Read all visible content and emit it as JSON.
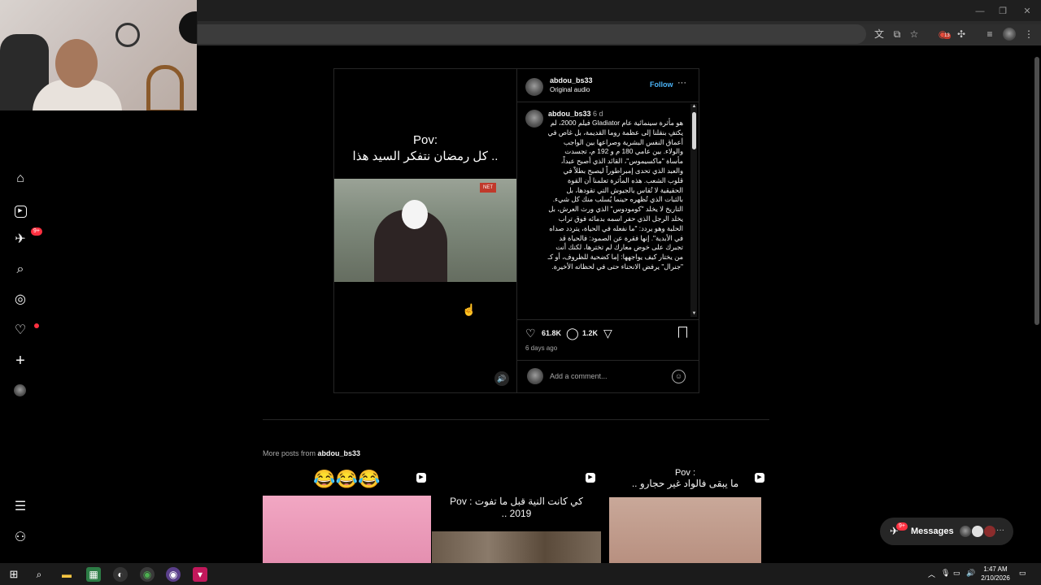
{
  "browser": {
    "window_controls": [
      "—",
      "❐",
      "✕"
    ],
    "toolbar_icons": [
      "translate-icon",
      "install-icon",
      "star-icon",
      "extension-ad-icon",
      "puzzle-icon",
      "tab-search-icon",
      "profile-icon",
      "menu-icon"
    ],
    "extension_badge": "13"
  },
  "sidebar": {
    "items": [
      {
        "name": "home",
        "glyph": "⌂"
      },
      {
        "name": "reels",
        "glyph": "▶"
      },
      {
        "name": "direct",
        "glyph": "✈",
        "badge": "9+"
      },
      {
        "name": "search",
        "glyph": "⌕"
      },
      {
        "name": "explore",
        "glyph": "◎"
      },
      {
        "name": "notifications",
        "glyph": "♡"
      },
      {
        "name": "create",
        "glyph": "+"
      },
      {
        "name": "profile",
        "glyph": "●"
      }
    ],
    "more_glyph": "☰",
    "threads_glyph": "⚇"
  },
  "post": {
    "media": {
      "pov_line1": "Pov:",
      "pov_line2": "كل رمضان نتفكر السيد هذا ..",
      "video_tag": "NET"
    },
    "header": {
      "username": "abdou_bs33",
      "audio": "Original audio",
      "follow_label": "Follow",
      "more_glyph": "···"
    },
    "caption": {
      "username": "abdou_bs33",
      "time": "6 d",
      "text": "هو مأثرة سينمائية عام Gladiator فيلم 2000، لم يكتفِ بنقلنا إلى عظمة روما القديمة، بل غاص في أعماق النفس البشرية وصراعها بين الواجب والولاء. بين عامي 180 م و 192 م، تجسدت مأساة \"ماكسيموس\"، القائد الذي أصبح عبداً، والعبد الذي تحدى إمبراطوراً ليصبح بطلاً في قلوب الشعب. هذه المأثرة تعلمنا أن القوة الحقيقية لا تُقاس بالجيوش التي تقودها، بل بالثبات الذي تُظهره حينما يُسلب منك كل شيء. التاريخ لا يخلد \"كومودوس\" الذي ورث العرش، بل يخلد الرجل الذي حفر اسمه بدمائه فوق تراب الحلبة وهو يردد: \"ما نفعله في الحياة، يتردد صداه في الأبدية\". إنها فقرة عن الصمود: فالحياة قد تجبرك على خوض معارك لم تخترها، لكنك أنت من يختار كيف يواجهها: إما كضحية للظروف، أو كـ \"جنرال\" يرفض الانحناء حتى في لحظاته الأخيرة."
    },
    "actions": {
      "likes": "61.8K",
      "comments": "1.2K",
      "posted_ago": "6 days ago"
    },
    "comment_placeholder": "Add a comment..."
  },
  "more_posts": {
    "prefix": "More posts from",
    "username": "abdou_bs33",
    "thumbs": [
      {
        "top_text": "😂😂😂",
        "caption": ""
      },
      {
        "top_text": "",
        "caption": "كي كانت النية قبل ما تفوت : Pov 2019 .."
      },
      {
        "top_text": "Pov :",
        "caption": "ما يبقى فالواد غير حجارو .."
      }
    ]
  },
  "messages": {
    "label": "Messages",
    "badge": "9+"
  },
  "taskbar": {
    "time": "1:47 AM",
    "date": "2/10/2026"
  },
  "colors": {
    "accent": "#4cb5f9",
    "badge": "#ff3040",
    "background": "#000000",
    "border": "#262626"
  }
}
